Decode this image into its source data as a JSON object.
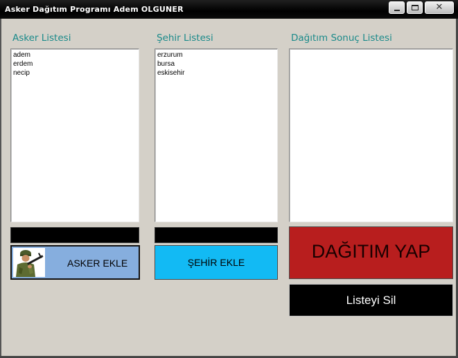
{
  "window": {
    "title": "Asker Dağıtım Programı Adem OLGUNER",
    "close_glyph": "✕"
  },
  "asker_panel": {
    "label": "Asker  Listesi",
    "items": [
      "adem",
      "erdem",
      "necip"
    ],
    "input_value": "",
    "button_label": "ASKER EKLE",
    "button_icon": "soldier-icon",
    "button_color": "#86aede"
  },
  "sehir_panel": {
    "label": "Şehir Listesi",
    "items": [
      "erzurum",
      "bursa",
      "eskisehir"
    ],
    "input_value": "",
    "button_label": "ŞEHİR EKLE",
    "button_color": "#12baf4"
  },
  "sonuc_panel": {
    "label": "Dağıtım Sonuç Listesi",
    "items": [],
    "dagitim_button_label": "DAĞITIM YAP",
    "dagitim_button_color": "#b81e1e",
    "sil_button_label": "Listeyi Sil",
    "sil_button_color": "#000000"
  },
  "colors": {
    "background": "#d4d0c8",
    "label_teal": "#1a8a8a"
  }
}
